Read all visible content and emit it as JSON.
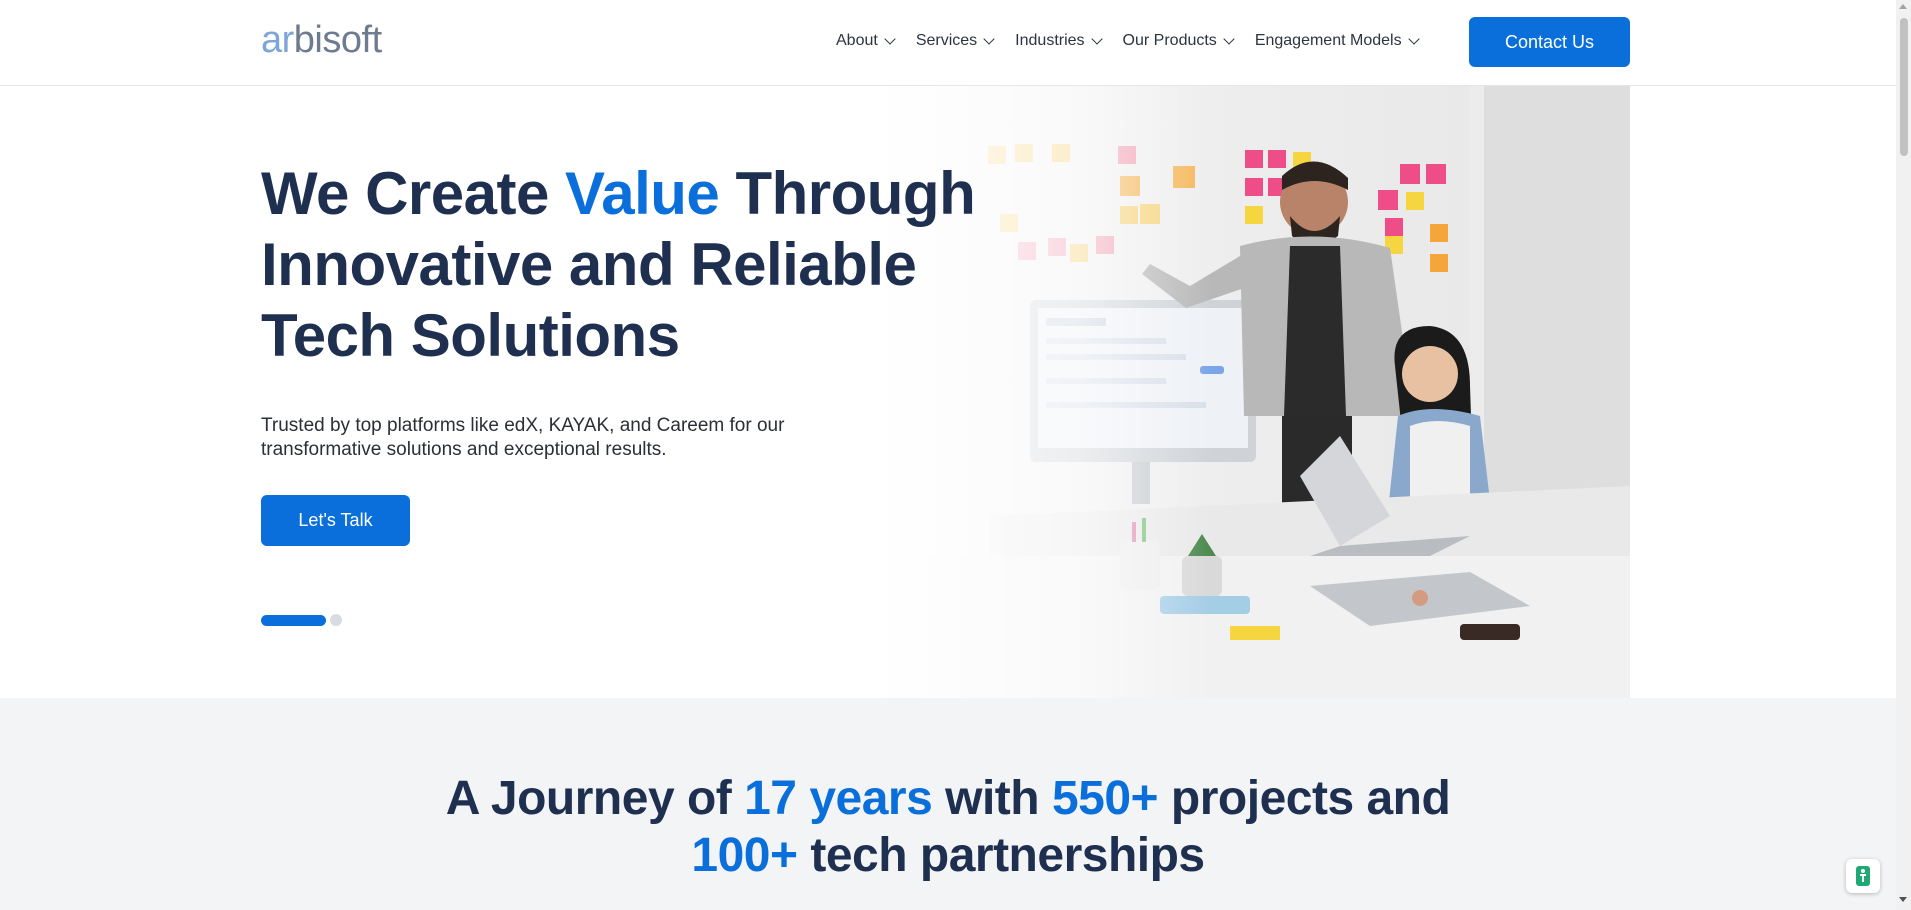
{
  "brand": {
    "logo_prefix": "ar",
    "logo_rest": "bisoft",
    "accent": "#0a6fdb",
    "heading_color": "#1e2f4f"
  },
  "nav": {
    "items": [
      {
        "label": "About"
      },
      {
        "label": "Services"
      },
      {
        "label": "Industries"
      },
      {
        "label": "Our Products"
      },
      {
        "label": "Engagement Models"
      }
    ],
    "contact_label": "Contact Us"
  },
  "hero": {
    "title_part1": "We Create ",
    "title_highlight": "Value",
    "title_part2": " Through Innovative and Reliable Tech Solutions",
    "subtitle": "Trusted by top platforms like edX, KAYAK, and Careem for our transformative solutions and exceptional results.",
    "cta_label": "Let's Talk",
    "slides_total": 2,
    "slide_active": 1
  },
  "journey": {
    "t1": "A Journey of ",
    "h1": "17 years",
    "t2": " with ",
    "h2": "550+",
    "t3": " projects and",
    "h3": "100+",
    "t4": " tech partnerships"
  },
  "floating_widget": {
    "icon": "accessibility-icon"
  }
}
